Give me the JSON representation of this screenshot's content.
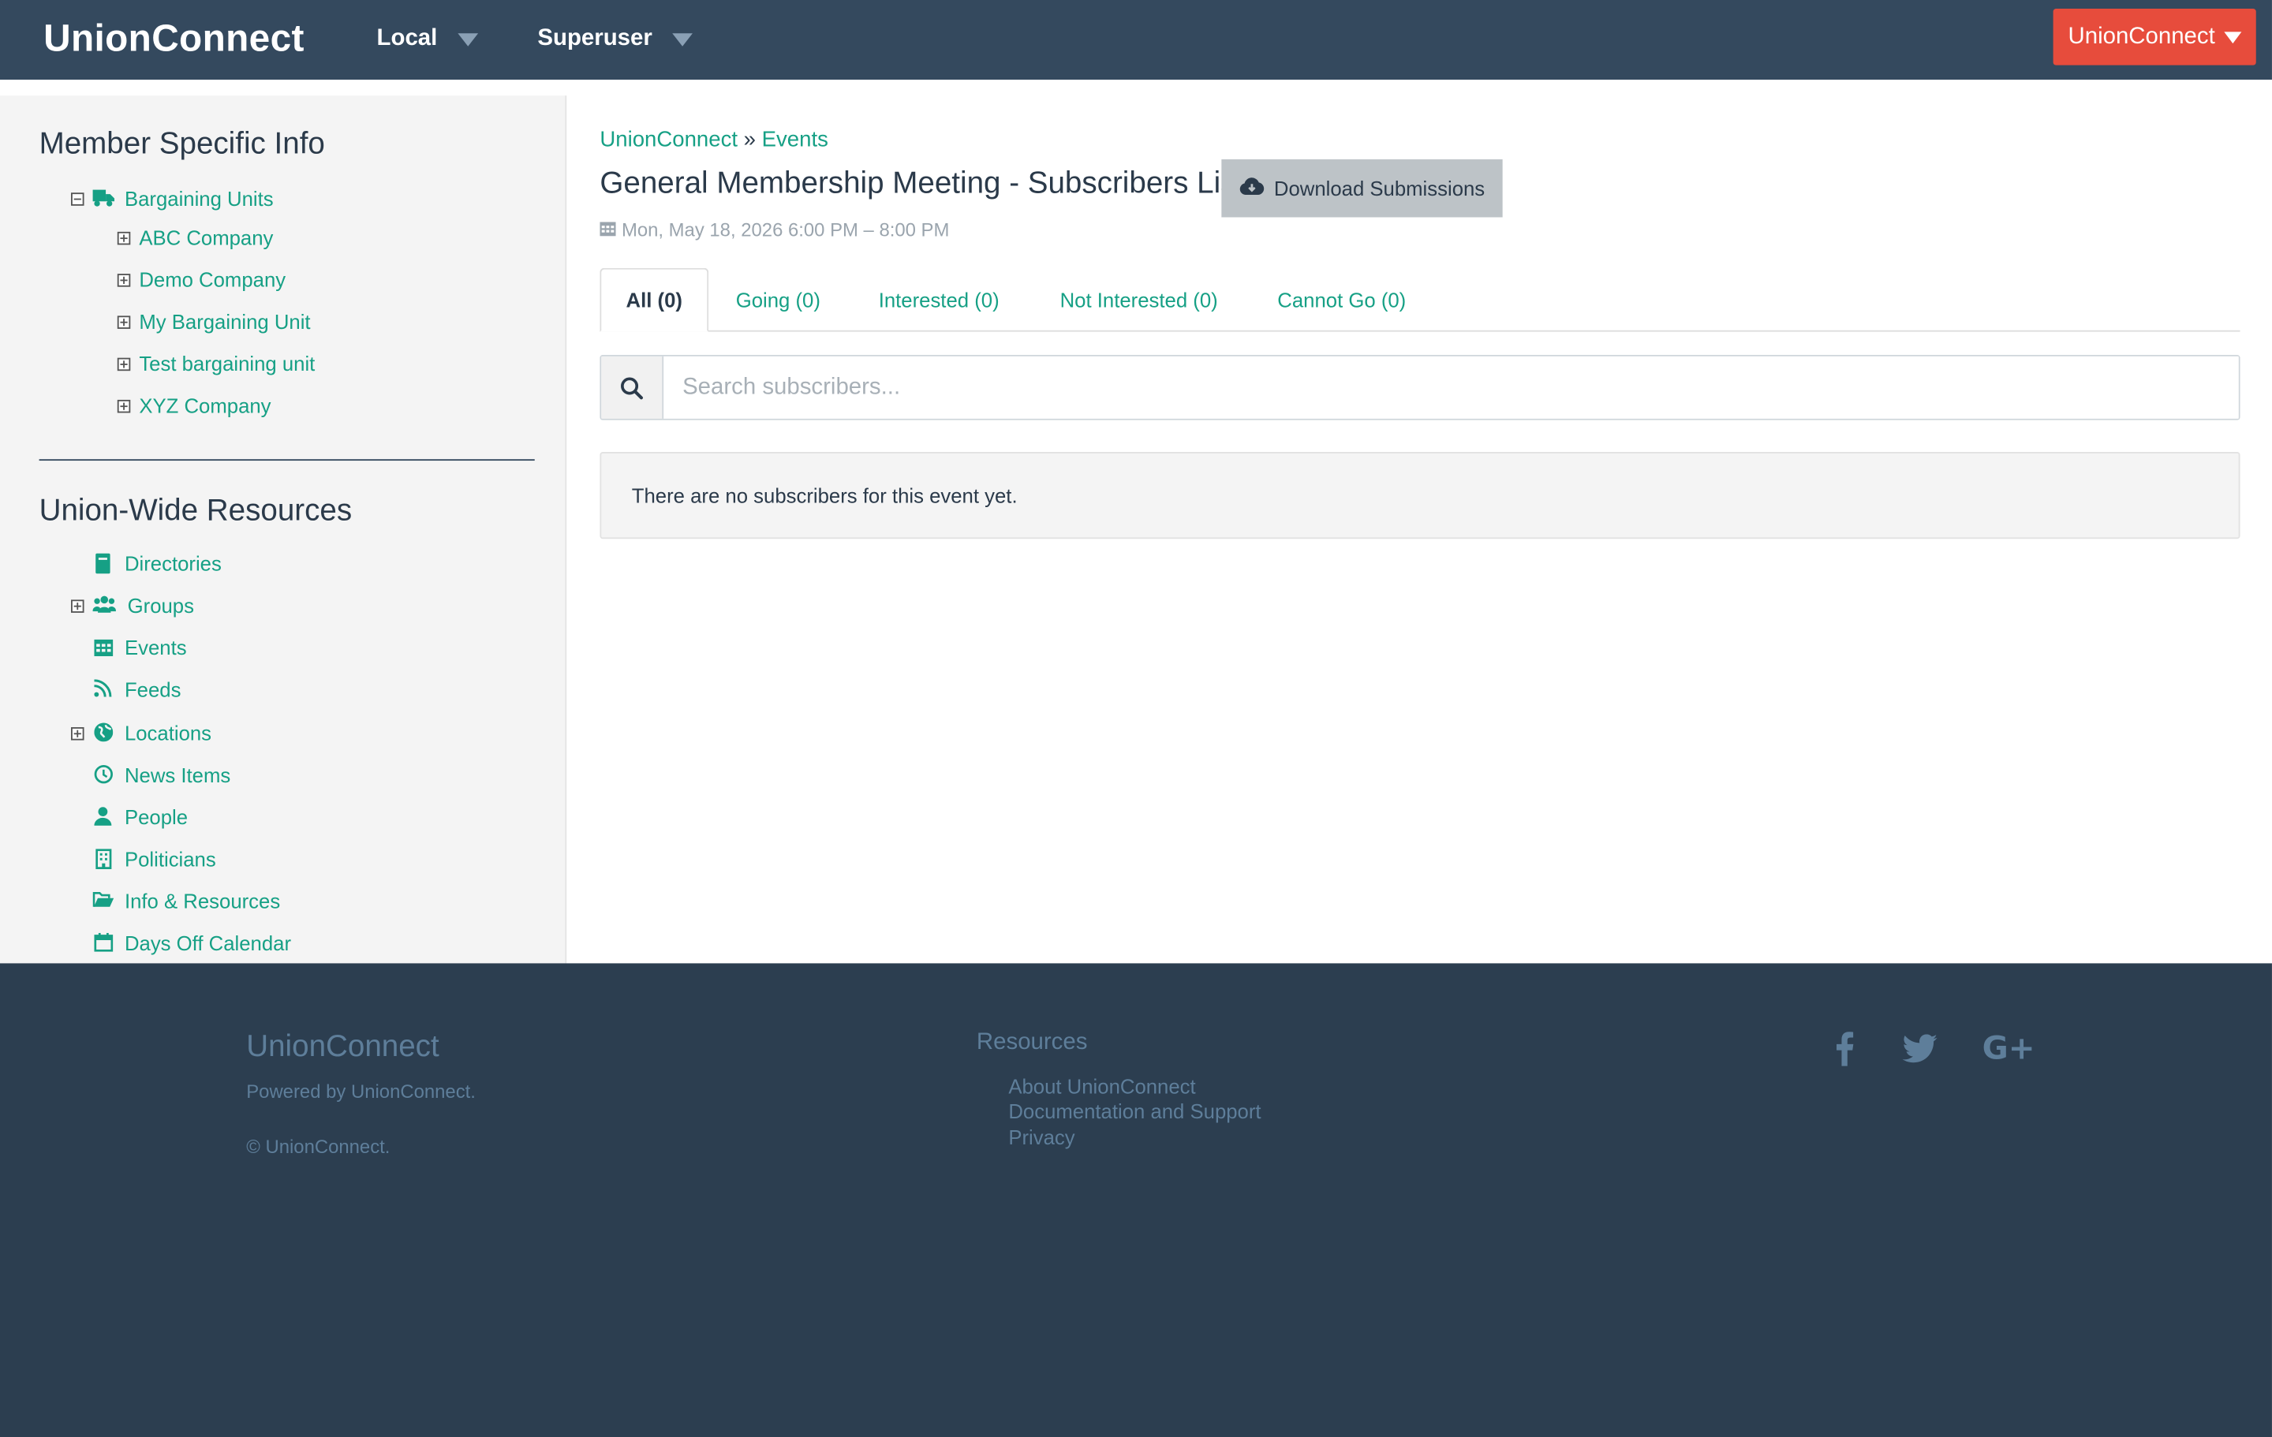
{
  "header": {
    "brand": "UnionConnect",
    "nav": [
      {
        "label": "Local"
      },
      {
        "label": "Superuser"
      }
    ],
    "account_button": "UnionConnect"
  },
  "sidebar": {
    "member_heading": "Member Specific Info",
    "bargaining_units": {
      "label": "Bargaining Units",
      "children": [
        "ABC Company",
        "Demo Company",
        "My Bargaining Unit",
        "Test bargaining unit",
        "XYZ Company"
      ]
    },
    "union_heading": "Union-Wide Resources",
    "resources": [
      {
        "label": "Directories",
        "icon": "book-icon"
      },
      {
        "label": "Groups",
        "icon": "users-icon"
      },
      {
        "label": "Events",
        "icon": "calendar-icon"
      },
      {
        "label": "Feeds",
        "icon": "rss-icon"
      },
      {
        "label": "Locations",
        "icon": "globe-icon"
      },
      {
        "label": "News Items",
        "icon": "clock-icon"
      },
      {
        "label": "People",
        "icon": "user-icon"
      },
      {
        "label": "Politicians",
        "icon": "building-icon"
      },
      {
        "label": "Info & Resources",
        "icon": "folder-open-icon"
      },
      {
        "label": "Days Off Calendar",
        "icon": "calendar-o-icon"
      }
    ]
  },
  "main": {
    "breadcrumb": {
      "root": "UnionConnect",
      "separator": "»",
      "current": "Events"
    },
    "title": "General Membership Meeting - Subscribers List",
    "download_button": "Download Submissions",
    "date": "Mon, May 18, 2026 6:00 PM – 8:00 PM",
    "tabs": [
      {
        "label": "All (0)"
      },
      {
        "label": "Going (0)"
      },
      {
        "label": "Interested (0)"
      },
      {
        "label": "Not Interested (0)"
      },
      {
        "label": "Cannot Go (0)"
      }
    ],
    "search_placeholder": "Search subscribers...",
    "empty_message": "There are no subscribers for this event yet."
  },
  "footer": {
    "brand": "UnionConnect",
    "powered_by": "Powered by UnionConnect.",
    "copyright": "© UnionConnect.",
    "resources_heading": "Resources",
    "links": [
      "About UnionConnect",
      "Documentation and Support",
      "Privacy"
    ],
    "social": {
      "facebook": "f",
      "google": "G+"
    }
  },
  "colors": {
    "topbar": "#34495e",
    "accent": "#16a085",
    "account": "#e74c3c",
    "footer": "#2c3e50"
  }
}
